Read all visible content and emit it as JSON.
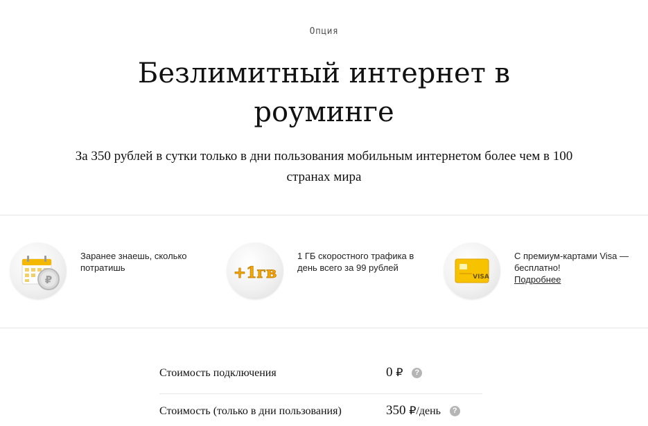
{
  "header": {
    "eyebrow": "Опция",
    "title": "Безлимитный интернет в роуминге",
    "subtitle": "За 350 рублей в сутки только в дни пользования мобильным интернетом более чем в 100 странах мира"
  },
  "features": [
    {
      "icon": "calendar-coin-icon",
      "text": "Заранее знаешь, сколько потратишь"
    },
    {
      "icon": "plus-1gb-icon",
      "text": "1 ГБ скоростного трафика в день всего за 99 рублей",
      "badge": "+1гв"
    },
    {
      "icon": "visa-card-icon",
      "text": "С премиум-картами Visa — бесплатно!",
      "link": "Подробнее",
      "card_label": "VISA"
    }
  ],
  "pricing": [
    {
      "label": "Стоимость подключения",
      "value": "0",
      "unit": "₽",
      "help": "?"
    },
    {
      "label": "Стоимость (только в дни пользования)",
      "value": "350",
      "unit": "₽/день",
      "help": "?"
    }
  ],
  "colors": {
    "accent_yellow": "#f5b800",
    "divider": "#e4e4e4",
    "help_icon": "#b5b5b5"
  }
}
